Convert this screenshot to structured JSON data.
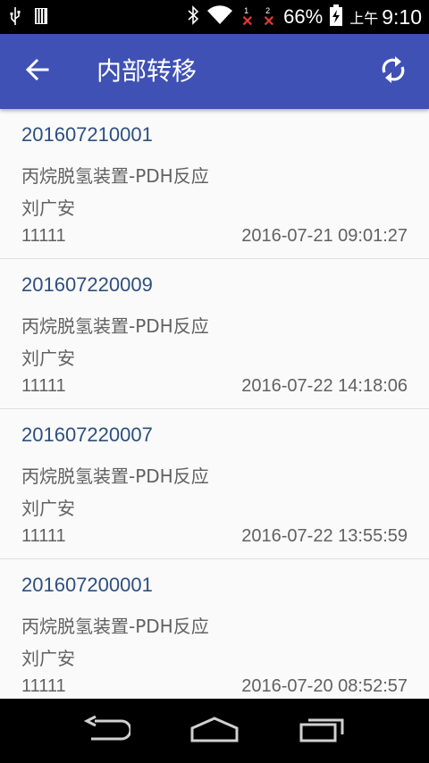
{
  "status_bar": {
    "icons": [
      "usb-icon",
      "sdcard-icon",
      "bluetooth-icon",
      "wifi-icon",
      "sim1-no-signal-icon",
      "sim2-no-signal-icon",
      "battery-charging-icon"
    ],
    "sim1_label": "1",
    "sim2_label": "2",
    "battery": "66%",
    "ampm": "上午",
    "time": "9:10"
  },
  "app_bar": {
    "title": "内部转移",
    "color": "#3f51b5"
  },
  "records": [
    {
      "id": "201607210001",
      "device": "丙烷脱氢装置-PDH反应",
      "person": "刘广安",
      "code": "11111",
      "time": "2016-07-21 09:01:27"
    },
    {
      "id": "201607220009",
      "device": "丙烷脱氢装置-PDH反应",
      "person": "刘广安",
      "code": "11111",
      "time": "2016-07-22 14:18:06"
    },
    {
      "id": "201607220007",
      "device": "丙烷脱氢装置-PDH反应",
      "person": "刘广安",
      "code": "11111",
      "time": "2016-07-22 13:55:59"
    },
    {
      "id": "201607200001",
      "device": "丙烷脱氢装置-PDH反应",
      "person": "刘广安",
      "code": "11111",
      "time": "2016-07-20 08:52:57"
    }
  ]
}
